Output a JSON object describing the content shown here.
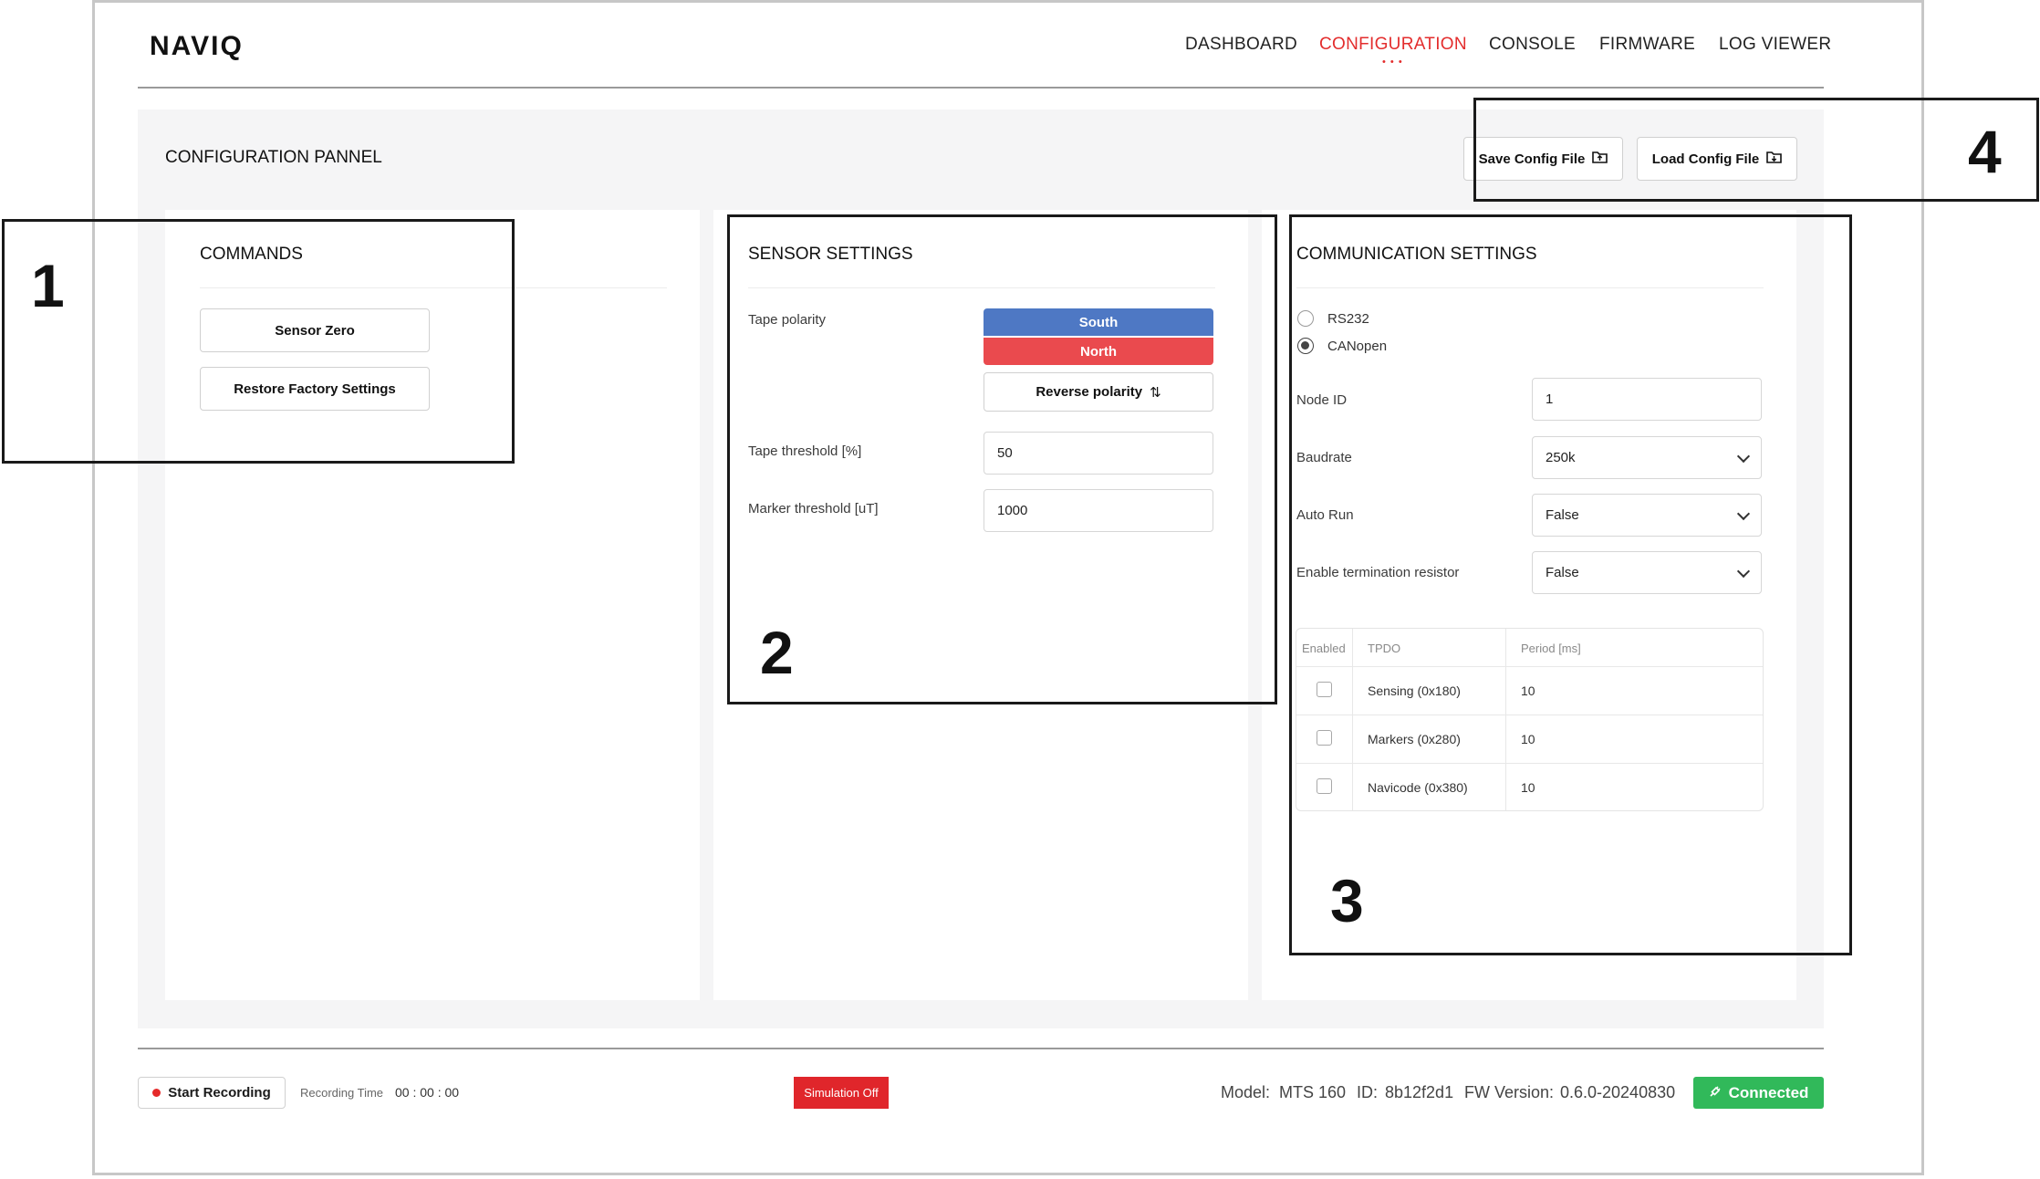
{
  "app": {
    "logo": "NAVIQ"
  },
  "nav": {
    "items": [
      "DASHBOARD",
      "CONFIGURATION",
      "CONSOLE",
      "FIRMWARE",
      "LOG VIEWER"
    ],
    "active": "CONFIGURATION",
    "active_indicator": "• • •"
  },
  "panel": {
    "title": "CONFIGURATION PANNEL",
    "save_label": "Save Config File",
    "load_label": "Load Config File"
  },
  "commands": {
    "title": "COMMANDS",
    "sensor_zero": "Sensor Zero",
    "restore_factory": "Restore Factory Settings"
  },
  "sensor": {
    "title": "SENSOR SETTINGS",
    "tape_polarity_label": "Tape polarity",
    "polarity_south": "South",
    "polarity_north": "North",
    "reverse_label": "Reverse polarity",
    "reverse_icon": "⇅",
    "tape_threshold_label": "Tape threshold [%]",
    "tape_threshold_value": "50",
    "marker_threshold_label": "Marker threshold [uT]",
    "marker_threshold_value": "1000"
  },
  "comm": {
    "title": "COMMUNICATION SETTINGS",
    "radio_options": [
      "RS232",
      "CANopen"
    ],
    "radio_selected": "CANopen",
    "node_id_label": "Node ID",
    "node_id_value": "1",
    "baudrate_label": "Baudrate",
    "baudrate_value": "250k",
    "auto_run_label": "Auto Run",
    "auto_run_value": "False",
    "termination_label": "Enable termination resistor",
    "termination_value": "False",
    "tpdo_headers": [
      "Enabled",
      "TPDO",
      "Period [ms]"
    ],
    "tpdo_rows": [
      {
        "enabled": false,
        "name": "Sensing (0x180)",
        "period": "10"
      },
      {
        "enabled": false,
        "name": "Markers (0x280)",
        "period": "10"
      },
      {
        "enabled": false,
        "name": "Navicode (0x380)",
        "period": "10"
      }
    ]
  },
  "annotations": [
    "1",
    "2",
    "3",
    "4"
  ],
  "footer": {
    "start_recording": "Start Recording",
    "recording_time_label": "Recording Time",
    "recording_time": "00 : 00 : 00",
    "simulation": "Simulation Off",
    "model_label": "Model:",
    "model_value": "MTS 160",
    "id_label": "ID:",
    "id_value": "8b12f2d1",
    "fw_label": "FW Version:",
    "fw_value": "0.6.0-20240830",
    "connected": "Connected"
  },
  "colors": {
    "accent_red": "#e32d2d",
    "south_blue": "#4e78c4",
    "north_red": "#ea4a4e",
    "connected_green": "#31b95a",
    "simulation_red": "#e0262b"
  },
  "icons": {
    "save": "folder-upload-icon",
    "load": "folder-download-icon",
    "reverse": "swap-vertical-icon",
    "record": "record-dot-icon",
    "connected": "plug-icon",
    "select": "chevron-down-icon"
  }
}
